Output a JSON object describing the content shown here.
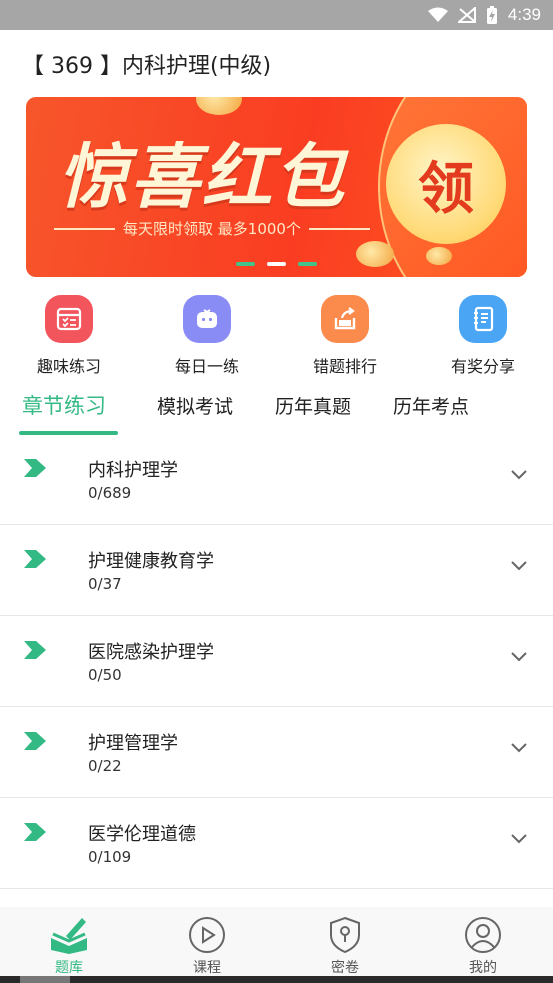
{
  "status_bar": {
    "time": "4:39"
  },
  "header": {
    "title": "【 369 】内科护理(中级)"
  },
  "banner": {
    "headline": "惊喜红包",
    "subtitle": "每天限时领取  最多1000个",
    "cta": "领",
    "slide_count": 3,
    "active_slide": 2
  },
  "quick_menu": [
    {
      "label": "趣味练习",
      "icon": "quiz-list-icon",
      "color": "#f2555c"
    },
    {
      "label": "每日一练",
      "icon": "robot-icon",
      "color": "#8a8cf5"
    },
    {
      "label": "错题排行",
      "icon": "share-box-icon",
      "color": "#fb8a4d"
    },
    {
      "label": "有奖分享",
      "icon": "notebook-icon",
      "color": "#4aa5f5"
    }
  ],
  "tabs": [
    {
      "label": "章节练习",
      "active": true
    },
    {
      "label": "模拟考试",
      "active": false
    },
    {
      "label": "历年真题",
      "active": false
    },
    {
      "label": "历年考点",
      "active": false
    }
  ],
  "chapters": [
    {
      "title": "内科护理学",
      "count": "0/689"
    },
    {
      "title": "护理健康教育学",
      "count": "0/37"
    },
    {
      "title": "医院感染护理学",
      "count": "0/50"
    },
    {
      "title": "护理管理学",
      "count": "0/22"
    },
    {
      "title": "医学伦理道德",
      "count": "0/109"
    }
  ],
  "bottom_nav": [
    {
      "label": "题库",
      "icon": "question-bank-icon",
      "active": true
    },
    {
      "label": "课程",
      "icon": "play-circle-icon",
      "active": false
    },
    {
      "label": "密卷",
      "icon": "shield-lock-icon",
      "active": false
    },
    {
      "label": "我的",
      "icon": "user-icon",
      "active": false
    }
  ],
  "colors": {
    "accent": "#33b983",
    "banner_red": "#fa3d22"
  }
}
